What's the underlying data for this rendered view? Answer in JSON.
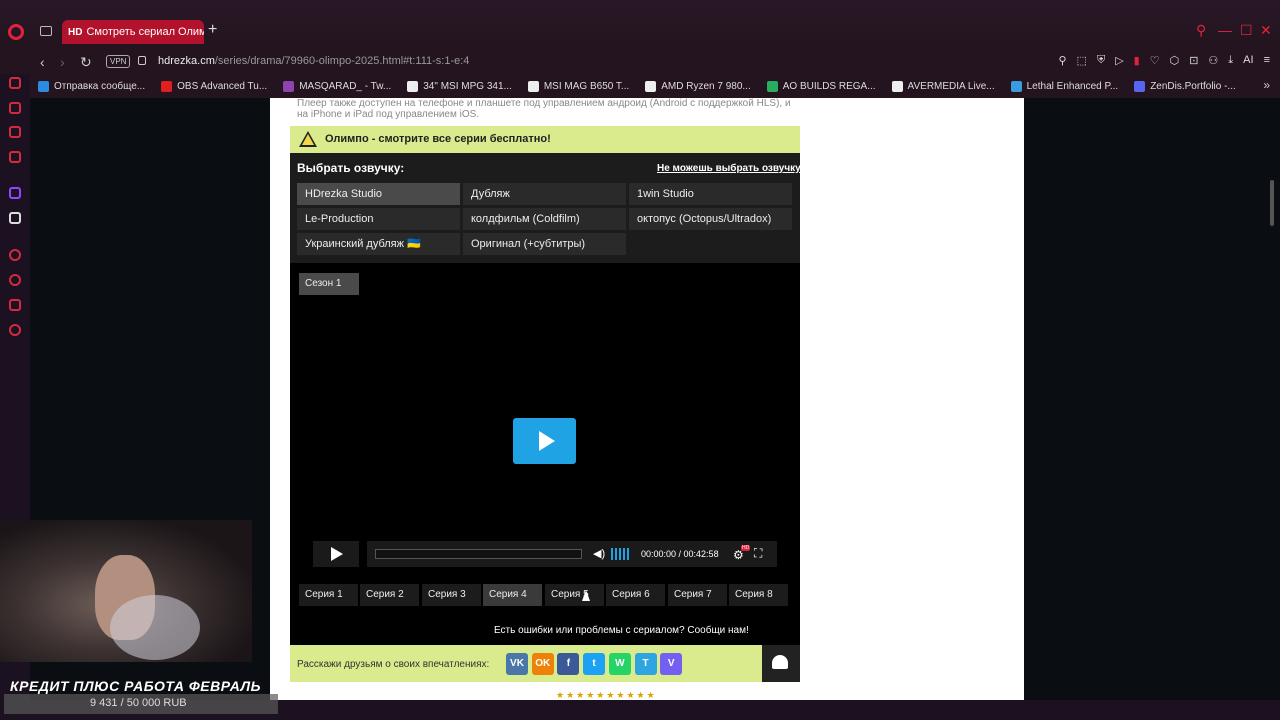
{
  "browser": {
    "tab_title": "Смотреть сериал Олимпо",
    "tab_favicon": "HD",
    "vpn_badge": "VPN",
    "url_host": "hdrezka.cm",
    "url_path": "/series/drama/79960-olimpo-2025.html#t:111-s:1-e:4",
    "ai_label": "AI"
  },
  "bookmarks": [
    {
      "label": "Отправка сообще...",
      "color": "#2a8be0"
    },
    {
      "label": "OBS Advanced Tu...",
      "color": "#e02020"
    },
    {
      "label": "MASQARAD_ - Tw...",
      "color": "#8e44ad"
    },
    {
      "label": "34\" MSI MPG 341...",
      "color": "#eeeeee"
    },
    {
      "label": "MSI MAG B650 T...",
      "color": "#eeeeee"
    },
    {
      "label": "AMD Ryzen 7 980...",
      "color": "#eeeeee"
    },
    {
      "label": "AO BUILDS REGA...",
      "color": "#27ae60"
    },
    {
      "label": "AVERMEDIA Live...",
      "color": "#eeeeee"
    },
    {
      "label": "Lethal Enhanced P...",
      "color": "#3a9be0"
    },
    {
      "label": "ZenDis.Portfolio -...",
      "color": "#5865f2"
    }
  ],
  "page": {
    "info_text": "Плеер также доступен на телефоне и планшете под управлением андроид (Android с поддержкой HLS), и на iPhone и iPad под управлением iOS.",
    "banner_text": "Олимпо - смотрите все серии бесплатно!",
    "translator_title": "Выбрать озвучку:",
    "translator_help": "Не можешь выбрать озвучку?",
    "translators": [
      "HDrezka Studio",
      "Дубляж",
      "1win Studio",
      "Le-Production",
      "колдфильм (Coldfilm)",
      "октопус (Octopus/Ultradox)",
      "Украинский дубляж 🇺🇦",
      "Оригинал (+субтитры)"
    ],
    "active_translator": "HDrezka Studio",
    "season_label": "Сезон 1",
    "time_display": "00:00:00 / 00:42:58",
    "hd_badge": "HD",
    "episodes": [
      "Серия 1",
      "Серия 2",
      "Серия 3",
      "Серия 4",
      "Серия 5",
      "Серия 6",
      "Серия 7",
      "Серия 8"
    ],
    "active_episode": "Серия 4",
    "report_text": "Есть ошибки или проблемы с сериалом? Сообщи нам!",
    "share_text": "Расскажи друзьям о своих впечатлениях:",
    "social": [
      {
        "label": "VK",
        "color": "#4a76a8"
      },
      {
        "label": "OK",
        "color": "#ee8208"
      },
      {
        "label": "f",
        "color": "#3b5998"
      },
      {
        "label": "t",
        "color": "#1da1f2"
      },
      {
        "label": "W",
        "color": "#25d366"
      },
      {
        "label": "T",
        "color": "#2ca5e0"
      },
      {
        "label": "V",
        "color": "#7360f2"
      }
    ]
  },
  "overlay": {
    "credit_title": "КРЕДИТ ПЛЮС РАБОТА ФЕВРАЛЬ",
    "credit_amount": "9 431 / 50 000 RUB"
  }
}
